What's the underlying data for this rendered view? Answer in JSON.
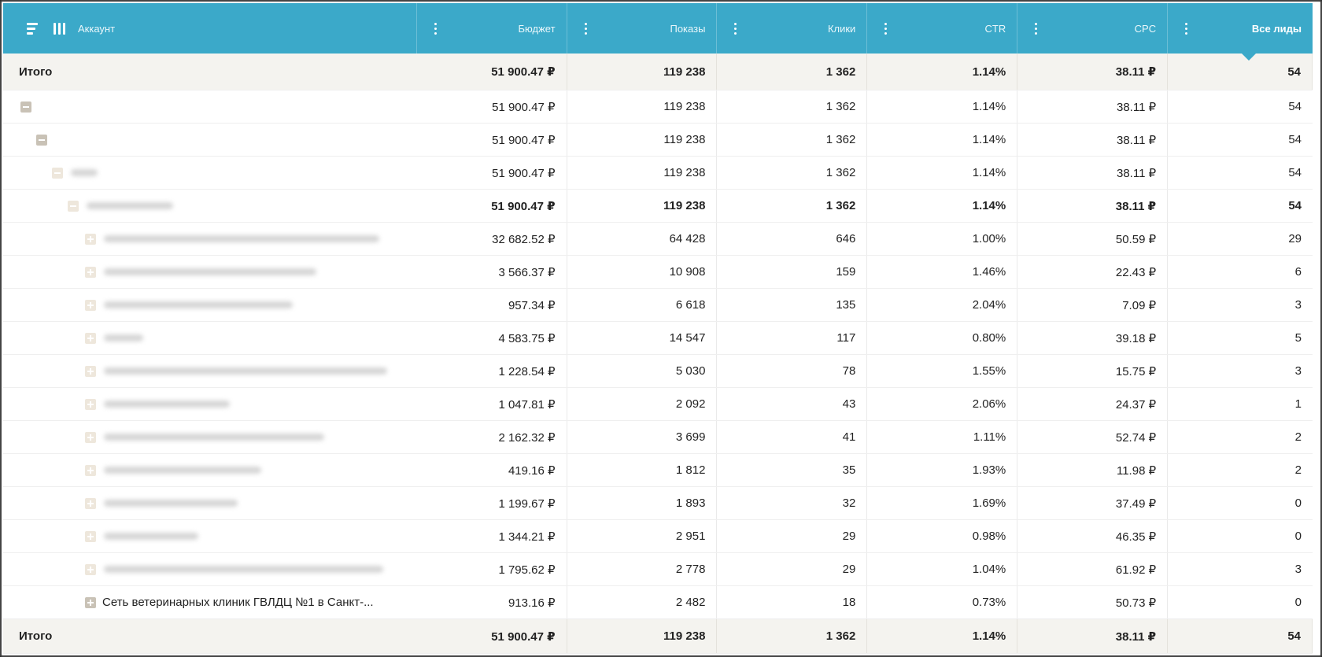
{
  "header": {
    "account_label": "Аккаунт",
    "columns": [
      "Бюджет",
      "Показы",
      "Клики",
      "CTR",
      "CPC",
      "Все лиды"
    ]
  },
  "total_top": {
    "label": "Итого",
    "values": [
      "51 900.47 ₽",
      "119 238",
      "1 362",
      "1.14%",
      "38.11 ₽",
      "54"
    ]
  },
  "rows": [
    {
      "values": [
        "51 900.47 ₽",
        "119 238",
        "1 362",
        "1.14%",
        "38.11 ₽",
        "54"
      ]
    },
    {
      "values": [
        "51 900.47 ₽",
        "119 238",
        "1 362",
        "1.14%",
        "38.11 ₽",
        "54"
      ]
    },
    {
      "values": [
        "51 900.47 ₽",
        "119 238",
        "1 362",
        "1.14%",
        "38.11 ₽",
        "54"
      ]
    },
    {
      "values": [
        "51 900.47 ₽",
        "119 238",
        "1 362",
        "1.14%",
        "38.11 ₽",
        "54"
      ]
    },
    {
      "values": [
        "32 682.52 ₽",
        "64 428",
        "646",
        "1.00%",
        "50.59 ₽",
        "29"
      ]
    },
    {
      "values": [
        "3 566.37 ₽",
        "10 908",
        "159",
        "1.46%",
        "22.43 ₽",
        "6"
      ]
    },
    {
      "values": [
        "957.34 ₽",
        "6 618",
        "135",
        "2.04%",
        "7.09 ₽",
        "3"
      ]
    },
    {
      "values": [
        "4 583.75 ₽",
        "14 547",
        "117",
        "0.80%",
        "39.18 ₽",
        "5"
      ]
    },
    {
      "values": [
        "1 228.54 ₽",
        "5 030",
        "78",
        "1.55%",
        "15.75 ₽",
        "3"
      ]
    },
    {
      "values": [
        "1 047.81 ₽",
        "2 092",
        "43",
        "2.06%",
        "24.37 ₽",
        "1"
      ]
    },
    {
      "values": [
        "2 162.32 ₽",
        "3 699",
        "41",
        "1.11%",
        "52.74 ₽",
        "2"
      ]
    },
    {
      "values": [
        "419.16 ₽",
        "1 812",
        "35",
        "1.93%",
        "11.98 ₽",
        "2"
      ]
    },
    {
      "values": [
        "1 199.67 ₽",
        "1 893",
        "32",
        "1.69%",
        "37.49 ₽",
        "0"
      ]
    },
    {
      "values": [
        "1 344.21 ₽",
        "2 951",
        "29",
        "0.98%",
        "46.35 ₽",
        "0"
      ]
    },
    {
      "values": [
        "1 795.62 ₽",
        "2 778",
        "29",
        "1.04%",
        "61.92 ₽",
        "3"
      ]
    },
    {
      "name": "Сеть ветеринарных клиник ГВЛДЦ №1 в Санкт-...",
      "values": [
        "913.16 ₽",
        "2 482",
        "18",
        "0.73%",
        "50.73 ₽",
        "0"
      ]
    }
  ],
  "total_bottom": {
    "label": "Итого",
    "values": [
      "51 900.47 ₽",
      "119 238",
      "1 362",
      "1.14%",
      "38.11 ₽",
      "54"
    ]
  }
}
